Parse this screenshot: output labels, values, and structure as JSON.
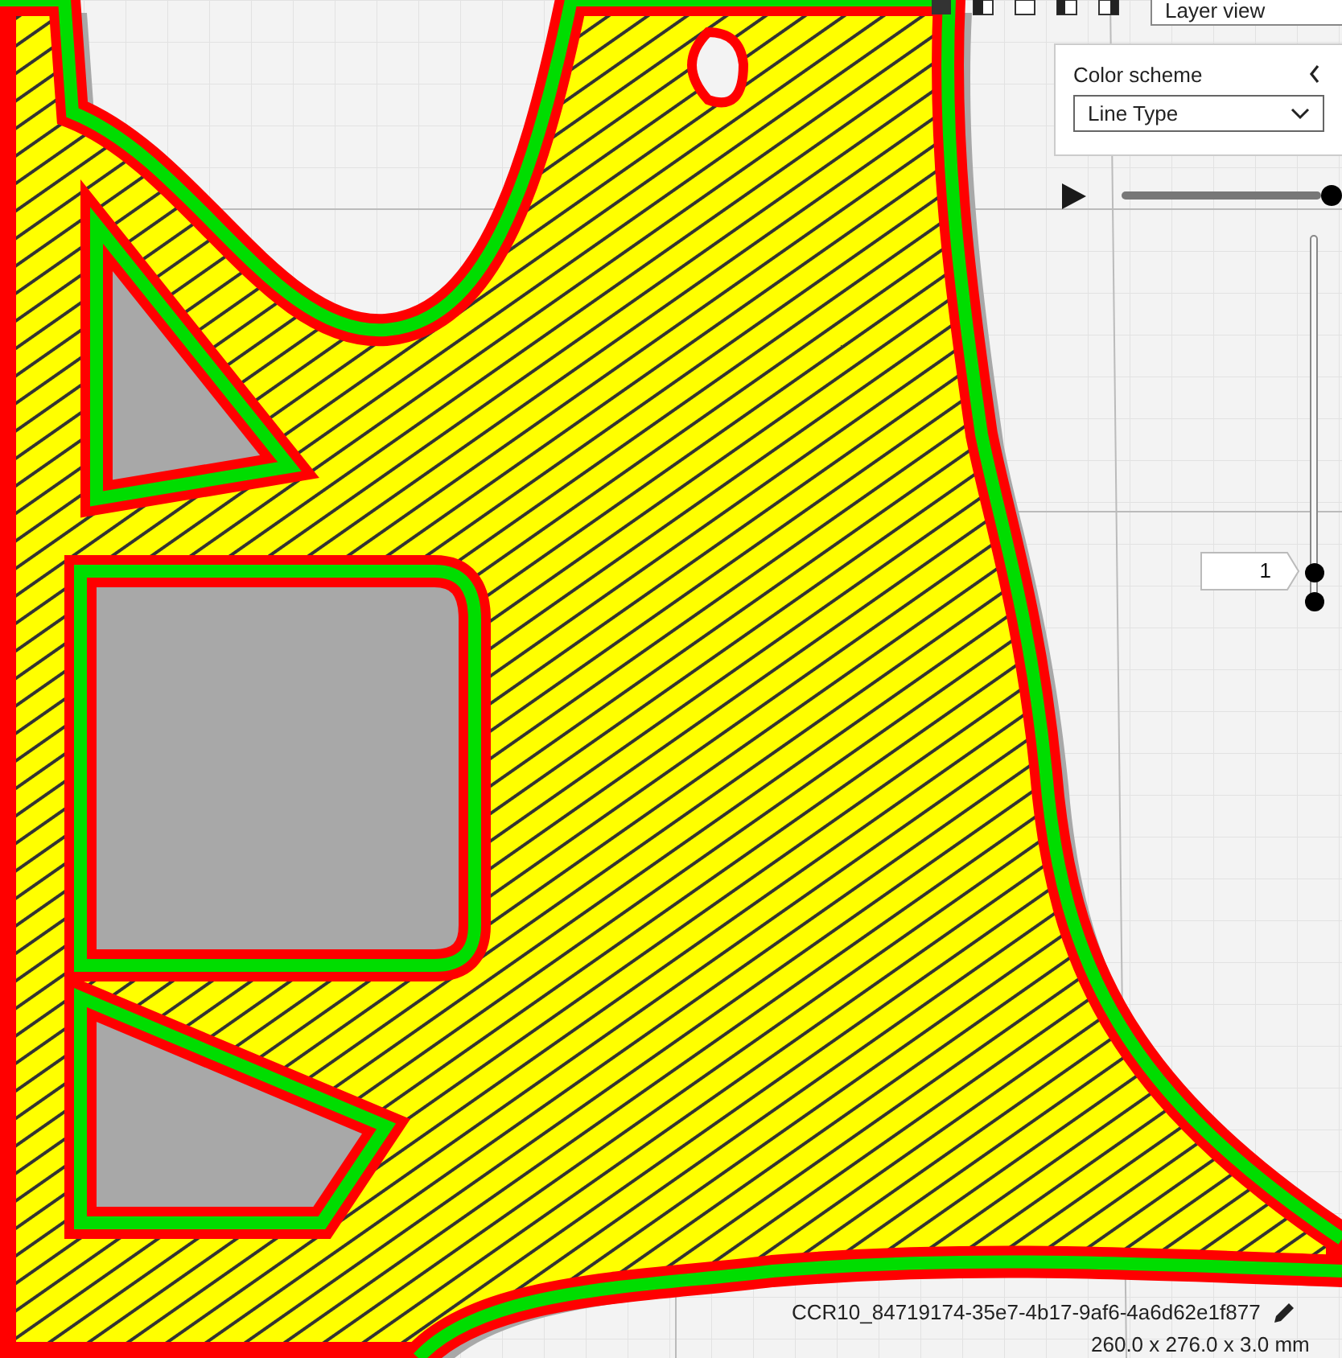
{
  "view_menu": {
    "value": "Layer view"
  },
  "color_scheme": {
    "title": "Color scheme",
    "value": "Line Type"
  },
  "simulation": {
    "level": 1
  },
  "layer_slider": {
    "value": "1"
  },
  "object": {
    "name": "CCR10_84719174-35e7-4b17-9af6-4a6d62e1f877",
    "dimensions": "260.0 x 276.0 x 3.0 mm"
  }
}
